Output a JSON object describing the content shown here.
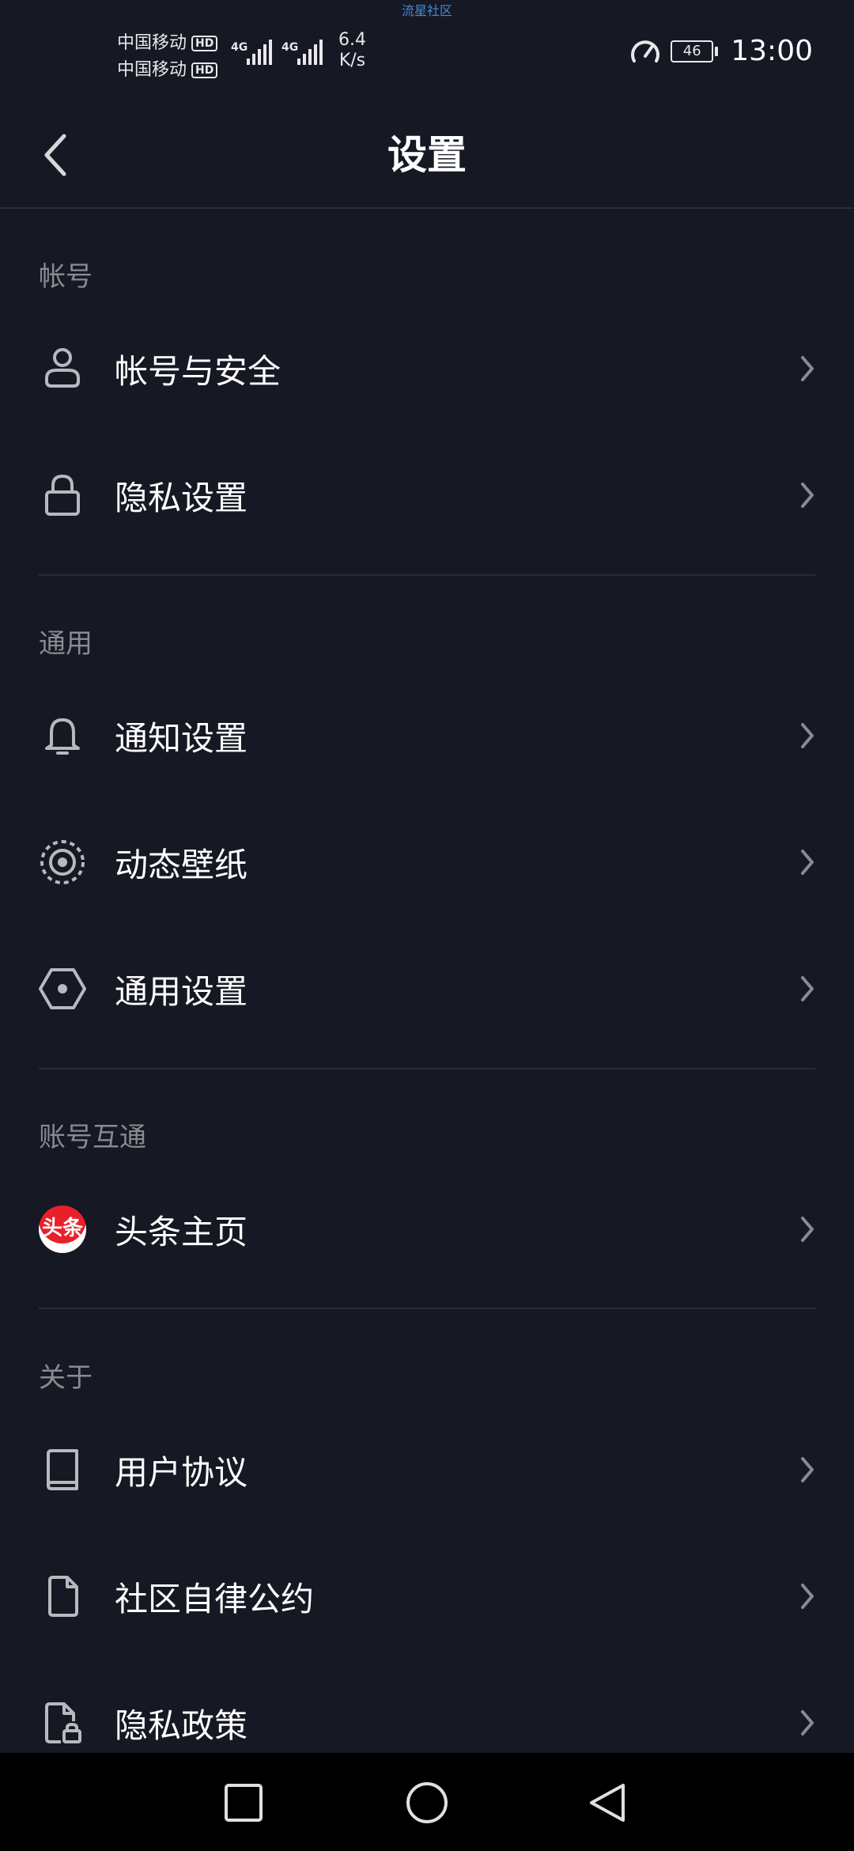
{
  "status_bar": {
    "watermark": "流星社区",
    "carriers": [
      "中国移动",
      "中国移动"
    ],
    "hd_badge": "HD",
    "network_types": [
      "4G",
      "4G"
    ],
    "net_speed_value": "6.4",
    "net_speed_unit": "K/s",
    "battery": "46",
    "time": "13:00"
  },
  "header": {
    "title": "设置"
  },
  "sections": {
    "account": {
      "title": "帐号",
      "items": [
        {
          "label": "帐号与安全",
          "icon": "user-icon"
        },
        {
          "label": "隐私设置",
          "icon": "lock-icon"
        }
      ]
    },
    "general": {
      "title": "通用",
      "items": [
        {
          "label": "通知设置",
          "icon": "bell-icon"
        },
        {
          "label": "动态壁纸",
          "icon": "live-wallpaper-icon"
        },
        {
          "label": "通用设置",
          "icon": "hexagon-settings-icon"
        }
      ]
    },
    "linked": {
      "title": "账号互通",
      "items": [
        {
          "label": "头条主页",
          "icon": "toutiao-logo",
          "logo_text": "头条"
        }
      ]
    },
    "about": {
      "title": "关于",
      "items": [
        {
          "label": "用户协议",
          "icon": "book-icon"
        },
        {
          "label": "社区自律公约",
          "icon": "document-icon"
        },
        {
          "label": "隐私政策",
          "icon": "privacy-document-icon"
        }
      ]
    }
  },
  "colors": {
    "background": "#161823",
    "text_primary": "#ffffff",
    "text_secondary": "#8a8b91",
    "divider": "#2a2c37",
    "icon": "#b8b9bd"
  }
}
